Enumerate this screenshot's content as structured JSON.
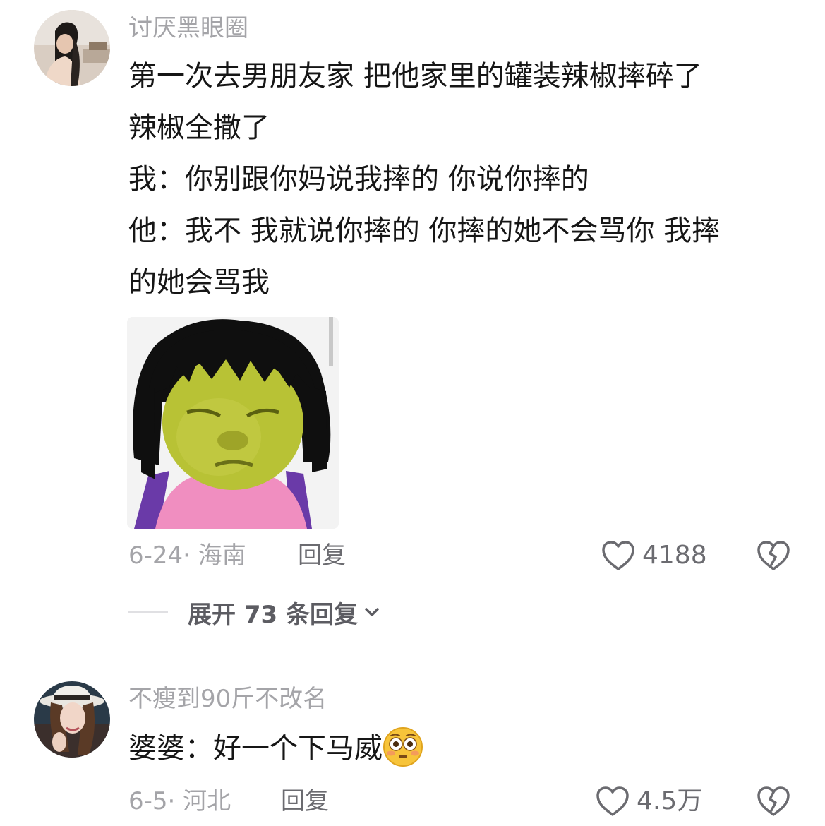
{
  "comments": [
    {
      "username": "讨厌黑眼圈",
      "avatar_icon": "user-avatar",
      "body_lines": [
        "第一次去男朋友家 把他家里的罐装辣椒摔碎了",
        "辣椒全撒了",
        "我：你别跟你妈说我摔的  你说你摔的",
        "他：我不 我就说你摔的 你摔的她不会骂你 我摔",
        "的她会骂我"
      ],
      "sticker_icon": "green-face-girl-sticker",
      "date_location": "6-24· 海南",
      "reply_label": "回复",
      "like_count": "4188",
      "expand_label": "展开 73 条回复"
    },
    {
      "username": "不瘦到90斤不改名",
      "avatar_icon": "user-avatar",
      "body_text": "婆婆：好一个下马威",
      "emoji_icon": "flushed-face-emoji",
      "date_location": "6-5· 河北",
      "reply_label": "回复",
      "like_count": "4.5万"
    }
  ],
  "colors": {
    "text_primary": "#161616",
    "text_secondary": "#a4a4a8",
    "text_action": "#6b6b70",
    "divider": "#e0e0e3"
  }
}
